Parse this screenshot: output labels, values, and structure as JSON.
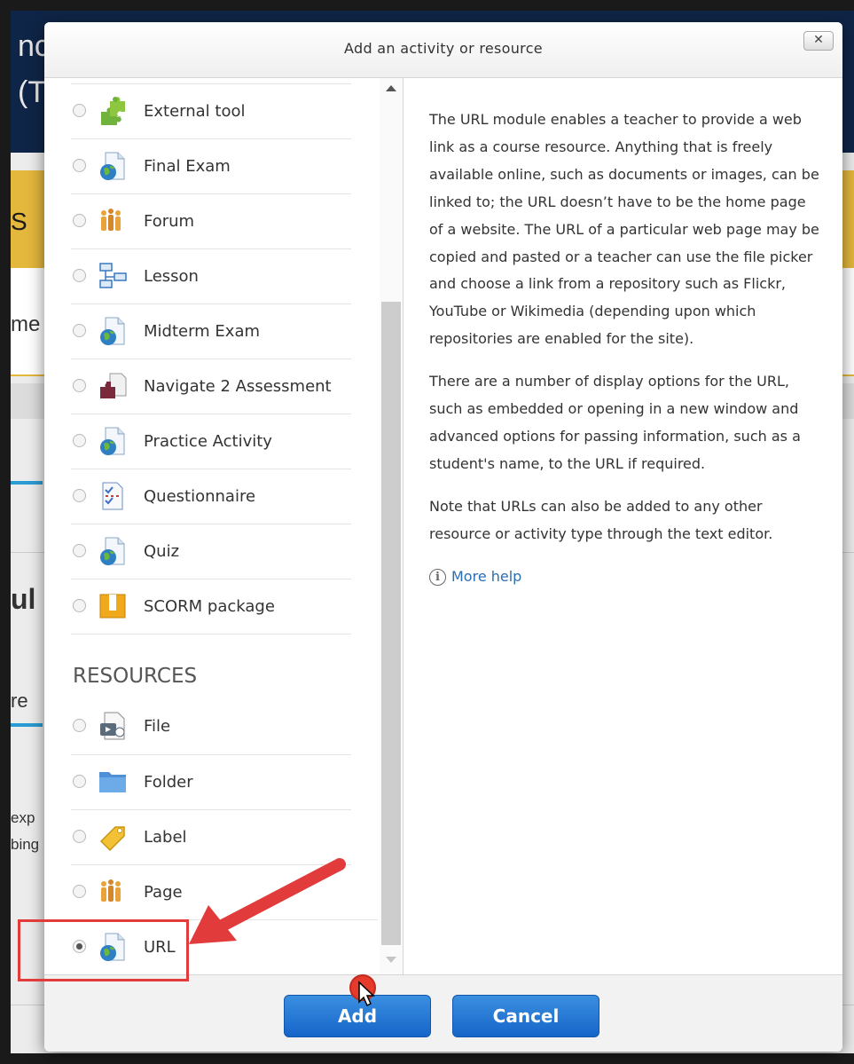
{
  "background": {
    "nav_line1": "ncy S",
    "nav_line2": "(T",
    "gold_frag": "S",
    "frag_me": "me",
    "frag_ul": "ul",
    "frag_re": "re",
    "frag_exp": "exp",
    "frag_bing": "bing"
  },
  "dialog": {
    "title": "Add an activity or resource",
    "close_label": "✕",
    "activities": [
      {
        "label": "External tool",
        "icon": "external-tool-puzzle-icon"
      },
      {
        "label": "Final Exam",
        "icon": "globe-page-icon"
      },
      {
        "label": "Forum",
        "icon": "forum-people-icon"
      },
      {
        "label": "Lesson",
        "icon": "lesson-flowchart-icon"
      },
      {
        "label": "Midterm Exam",
        "icon": "globe-page-icon"
      },
      {
        "label": "Navigate 2 Assessment",
        "icon": "assessment-puzzle-icon"
      },
      {
        "label": "Practice Activity",
        "icon": "globe-page-icon"
      },
      {
        "label": "Questionnaire",
        "icon": "questionnaire-checklist-icon"
      },
      {
        "label": "Quiz",
        "icon": "globe-page-icon"
      },
      {
        "label": "SCORM package",
        "icon": "scorm-box-icon"
      }
    ],
    "resources_heading": "RESOURCES",
    "resources": [
      {
        "label": "File",
        "icon": "file-media-icon"
      },
      {
        "label": "Folder",
        "icon": "folder-icon"
      },
      {
        "label": "Label",
        "icon": "label-tag-icon"
      },
      {
        "label": "Page",
        "icon": "page-people-icon"
      },
      {
        "label": "URL",
        "icon": "globe-page-icon",
        "selected": true
      }
    ],
    "help": {
      "p1": "The URL module enables a teacher to provide a web link as a course resource. Anything that is freely available online, such as documents or images, can be linked to; the URL doesn’t have to be the home page of a website. The URL of a particular web page may be copied and pasted or a teacher can use the file picker and choose a link from a repository such as Flickr, YouTube or Wikimedia (depending upon which repositories are enabled for the site).",
      "p2": "There are a number of display options for the URL, such as embedded or opening in a new window and advanced options for passing information, such as a student's name, to the URL if required.",
      "p3": "Note that URLs can also be added to any other resource or activity type through the text editor.",
      "more_help": "More help",
      "info_glyph": "i"
    },
    "buttons": {
      "add": "Add",
      "cancel": "Cancel"
    }
  },
  "colors": {
    "primary_button": "#1565c9",
    "annotation_red": "#e23b3b",
    "link": "#2a6db0"
  }
}
